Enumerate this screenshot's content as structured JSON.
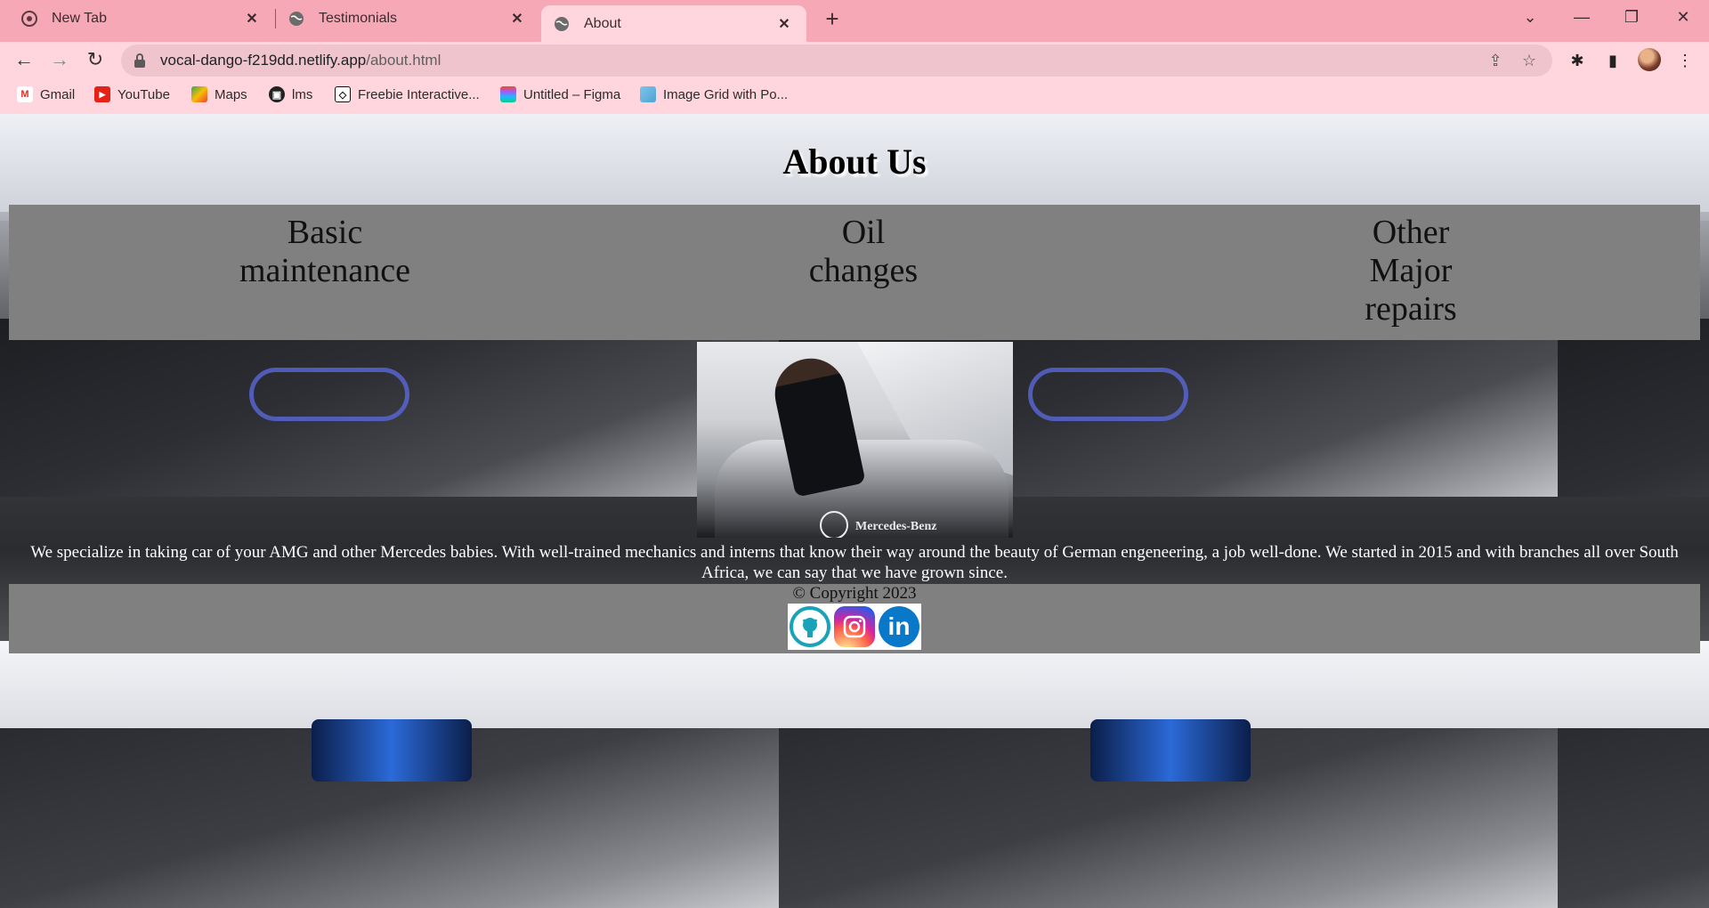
{
  "browser": {
    "tabs": [
      {
        "title": "New Tab",
        "favicon": "chrome-icon",
        "active": false
      },
      {
        "title": "Testimonials",
        "favicon": "globe-icon",
        "active": false
      },
      {
        "title": "About",
        "favicon": "globe-icon",
        "active": true
      }
    ],
    "url_host": "vocal-dango-f219dd.netlify.app",
    "url_path": "/about.html",
    "bookmarks": [
      {
        "label": "Gmail",
        "icon": "gmail-icon"
      },
      {
        "label": "YouTube",
        "icon": "youtube-icon"
      },
      {
        "label": "Maps",
        "icon": "maps-icon"
      },
      {
        "label": "lms",
        "icon": "lms-icon"
      },
      {
        "label": "Freebie Interactive...",
        "icon": "codepen-icon"
      },
      {
        "label": "Untitled – Figma",
        "icon": "figma-icon"
      },
      {
        "label": "Image Grid with Po...",
        "icon": "image-grid-icon"
      }
    ],
    "colors": {
      "tabstrip": "#f7a8b6",
      "toolbar": "#ffd6dd",
      "omnibox": "#efc4cc"
    }
  },
  "page": {
    "heading": "About Us",
    "services": [
      "Basic maintenance",
      "Oil changes",
      "Other Major repairs"
    ],
    "photo_brand": "Mercedes-Benz",
    "about_text": "We specialize in taking car of your AMG and other Mercedes babies. With well-trained mechanics and interns that know their way around the beauty of German engeneering, a job well-done. We started in 2015 and with branches all over South Africa, we can say that we have grown since.",
    "copyright": "© Copyright 2023",
    "socials": [
      {
        "name": "github",
        "icon": "github-icon"
      },
      {
        "name": "instagram",
        "icon": "instagram-icon"
      },
      {
        "name": "linkedin",
        "icon": "linkedin-icon",
        "glyph": "in"
      }
    ],
    "colors": {
      "panel": "#808080",
      "text_light": "#ffffff"
    }
  }
}
